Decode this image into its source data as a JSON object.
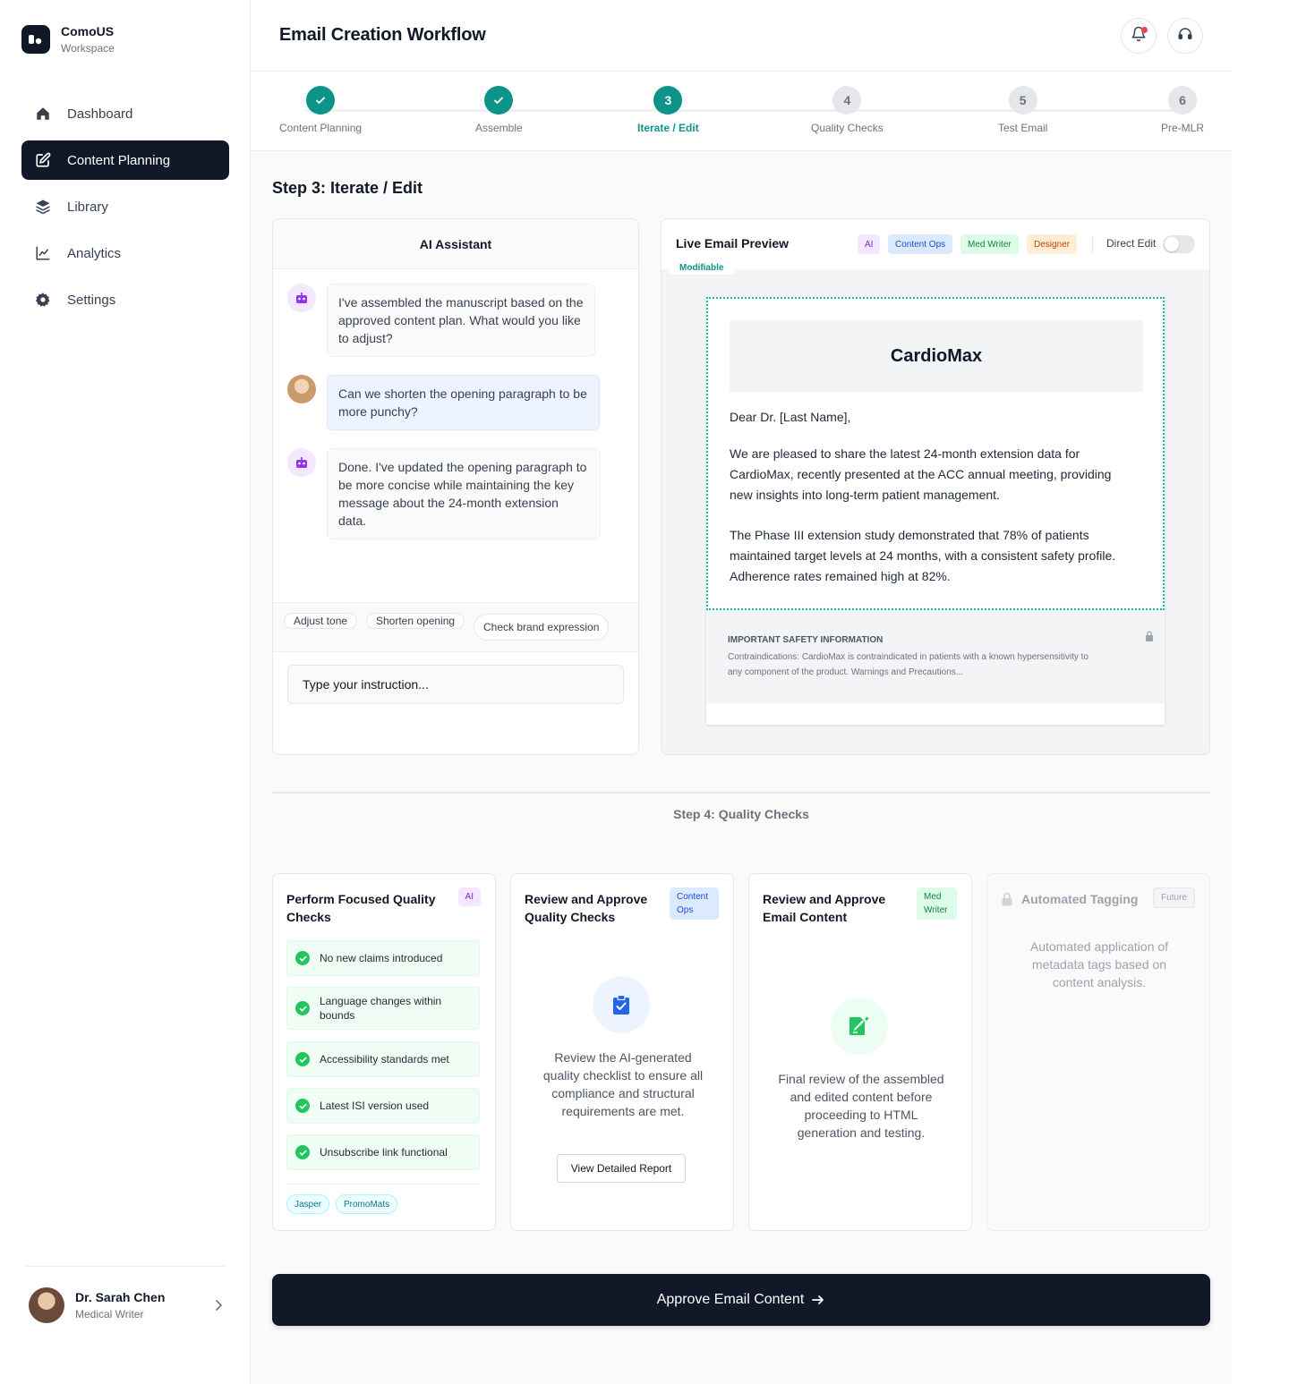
{
  "brand": {
    "name": "ComoUS",
    "subtitle": "Workspace"
  },
  "nav": [
    {
      "label": "Dashboard",
      "icon": "home-icon"
    },
    {
      "label": "Content Planning",
      "icon": "edit-icon",
      "active": true
    },
    {
      "label": "Library",
      "icon": "layers-icon"
    },
    {
      "label": "Analytics",
      "icon": "chart-line-icon"
    },
    {
      "label": "Settings",
      "icon": "gear-icon"
    }
  ],
  "user": {
    "name": "Dr. Sarah Chen",
    "role": "Medical Writer"
  },
  "header": {
    "title": "Email Creation Workflow"
  },
  "steps": [
    {
      "number": "1",
      "label": "Content Planning",
      "status": "done"
    },
    {
      "number": "2",
      "label": "Assemble",
      "status": "done"
    },
    {
      "number": "3",
      "label": "Iterate / Edit",
      "status": "current"
    },
    {
      "number": "4",
      "label": "Quality Checks",
      "status": "pending"
    },
    {
      "number": "5",
      "label": "Test Email",
      "status": "pending"
    },
    {
      "number": "6",
      "label": "Pre-MLR",
      "status": "pending"
    }
  ],
  "step3": {
    "title": "Step 3: Iterate / Edit"
  },
  "assistant": {
    "title": "AI Assistant",
    "messages": [
      {
        "from": "bot",
        "text": "I've assembled the manuscript based on the approved content plan. What would you like to adjust?"
      },
      {
        "from": "user",
        "text": "Can we shorten the opening paragraph to be more punchy?"
      },
      {
        "from": "bot",
        "text": "Done. I've updated the opening paragraph to be more concise while maintaining the key message about the 24-month extension data."
      }
    ],
    "suggestions": [
      "Adjust tone",
      "Shorten opening",
      "Check brand expression"
    ],
    "input_placeholder": "Type your instruction..."
  },
  "preview": {
    "title": "Live Email Preview",
    "tags": [
      "AI",
      "Content Ops",
      "Med Writer",
      "Designer"
    ],
    "direct_edit_label": "Direct Edit",
    "direct_edit_on": false,
    "modifiable_label": "Modifiable",
    "email": {
      "brand": "CardioMax",
      "greeting": "Dear Dr. [Last Name],",
      "para1": "We are pleased to share the latest 24-month extension data for CardioMax, recently presented at the ACC annual meeting, providing new insights into long-term patient management.",
      "para2": "The Phase III extension study demonstrated that 78% of patients maintained target levels at 24 months, with a consistent safety profile. Adherence rates remained high at 82%.",
      "isi_title": "IMPORTANT SAFETY INFORMATION",
      "isi_text": "Contraindications: CardioMax is contraindicated in patients with a known hypersensitivity to any component of the product. Warnings and Precautions..."
    }
  },
  "step4": {
    "title": "Step 4: Quality Checks",
    "cards": [
      {
        "title": "Perform Focused Quality Checks",
        "tag": "AI",
        "checks": [
          "No new claims introduced",
          "Language changes within bounds",
          "Accessibility standards met",
          "Latest ISI version used",
          "Unsubscribe link functional"
        ],
        "tools": [
          "Jasper",
          "PromoMats"
        ]
      },
      {
        "title": "Review and Approve Quality Checks",
        "tag": "Content Ops",
        "description": "Review the AI-generated quality checklist to ensure all compliance and structural requirements are met.",
        "button": "View Detailed Report"
      },
      {
        "title": "Review and Approve Email Content",
        "tag": "Med Writer",
        "description": "Final review of the assembled and edited content before proceeding to HTML generation and testing."
      },
      {
        "title": "Automated Tagging",
        "tag": "Future",
        "description": "Automated application of metadata tags based on content analysis."
      }
    ]
  },
  "approve_button": "Approve Email Content",
  "colors": {
    "accent": "#0d9488",
    "dark": "#111827",
    "success": "#22c55e"
  }
}
